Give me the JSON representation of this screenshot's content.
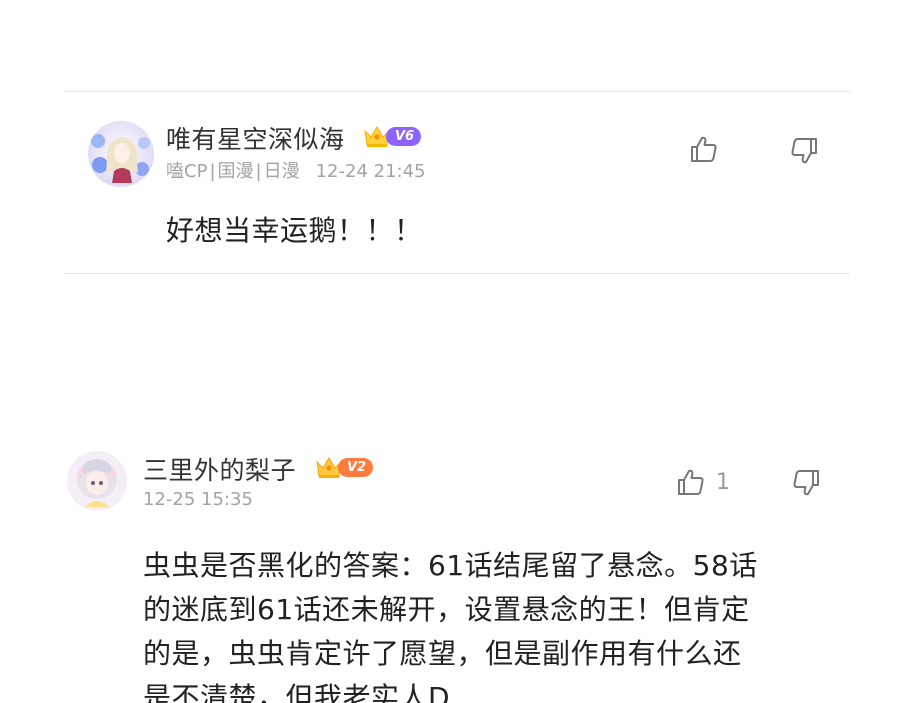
{
  "comments": [
    {
      "username": "唯有星空深似海",
      "vip_level": "V6",
      "tags": [
        "嗑CP",
        "国漫",
        "日漫"
      ],
      "time": "12-24 21:45",
      "text": "好想当幸运鹅！！！",
      "like_count": "",
      "vip_color": "#8c63ff"
    },
    {
      "username": "三里外的梨子",
      "vip_level": "V2",
      "tags": [],
      "time": "12-25 15:35",
      "text_lines": [
        "虫虫是否黑化的答案：61话结尾留了悬念。58话",
        "的迷底到61话还未解开，设置悬念的王！但肯定",
        "的是，虫虫肯定许了愿望，但是副作用有什么还",
        "是不清楚，但我老实人D"
      ],
      "like_count": "1",
      "vip_color": "#ff7a3d"
    }
  ],
  "icons": {
    "like": "thumbs-up-icon",
    "dislike": "thumbs-down-icon",
    "crown": "crown-icon"
  }
}
